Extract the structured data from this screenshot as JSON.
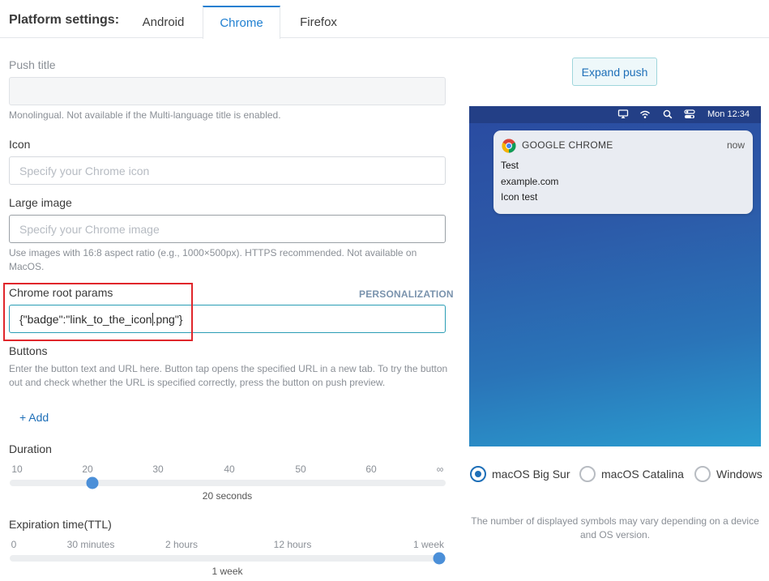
{
  "header": {
    "platform_label": "Platform settings:",
    "tabs": [
      {
        "label": "Android"
      },
      {
        "label": "Chrome"
      },
      {
        "label": "Firefox"
      }
    ]
  },
  "form": {
    "push_title": {
      "label": "Push title",
      "value": "",
      "hint": "Monolingual. Not available if the Multi-language title is enabled."
    },
    "icon": {
      "label": "Icon",
      "placeholder": "Specify your Chrome icon"
    },
    "large_image": {
      "label": "Large image",
      "placeholder": "Specify your Chrome image",
      "hint": "Use images with 16:8 aspect ratio (e.g., 1000×500px). HTTPS recommended. Not available on MacOS."
    },
    "root_params": {
      "label": "Chrome root params",
      "value_before_caret": "{\"badge\":\"link_to_the_icon",
      "value_after_caret": ".png\"}",
      "personalization": "PERSONALIZATION"
    },
    "buttons": {
      "label": "Buttons",
      "hint": "Enter the button text and URL here. Button tap opens the specified URL in a new tab. To try the button out and check whether the URL is specified correctly, press the button on push preview.",
      "add_label": "+ Add"
    },
    "duration": {
      "label": "Duration",
      "ticks": [
        "10",
        "20",
        "30",
        "40",
        "50",
        "60",
        "∞"
      ],
      "value_text": "20 seconds",
      "position_fraction": 0.1667
    },
    "ttl": {
      "label": "Expiration time(TTL)",
      "ticks": [
        "0",
        "30 minutes",
        "2 hours",
        "12 hours",
        "1 week"
      ],
      "value_text": "1 week",
      "position_fraction": 1.0
    }
  },
  "preview": {
    "expand_label": "Expand push",
    "menubar_time": "Mon 12:34",
    "notification": {
      "app": "GOOGLE CHROME",
      "time": "now",
      "title": "Test",
      "domain": "example.com",
      "body": "Icon test"
    },
    "os_options": [
      {
        "label": "macOS Big Sur",
        "selected": true
      },
      {
        "label": "macOS Catalina",
        "selected": false
      },
      {
        "label": "Windows",
        "selected": false
      }
    ],
    "note": "The number of displayed symbols may vary depending on a device and OS version."
  },
  "colors": {
    "accent": "#1e7fd1",
    "highlight": "#e0262b",
    "slider_thumb": "#4b8fd8"
  }
}
